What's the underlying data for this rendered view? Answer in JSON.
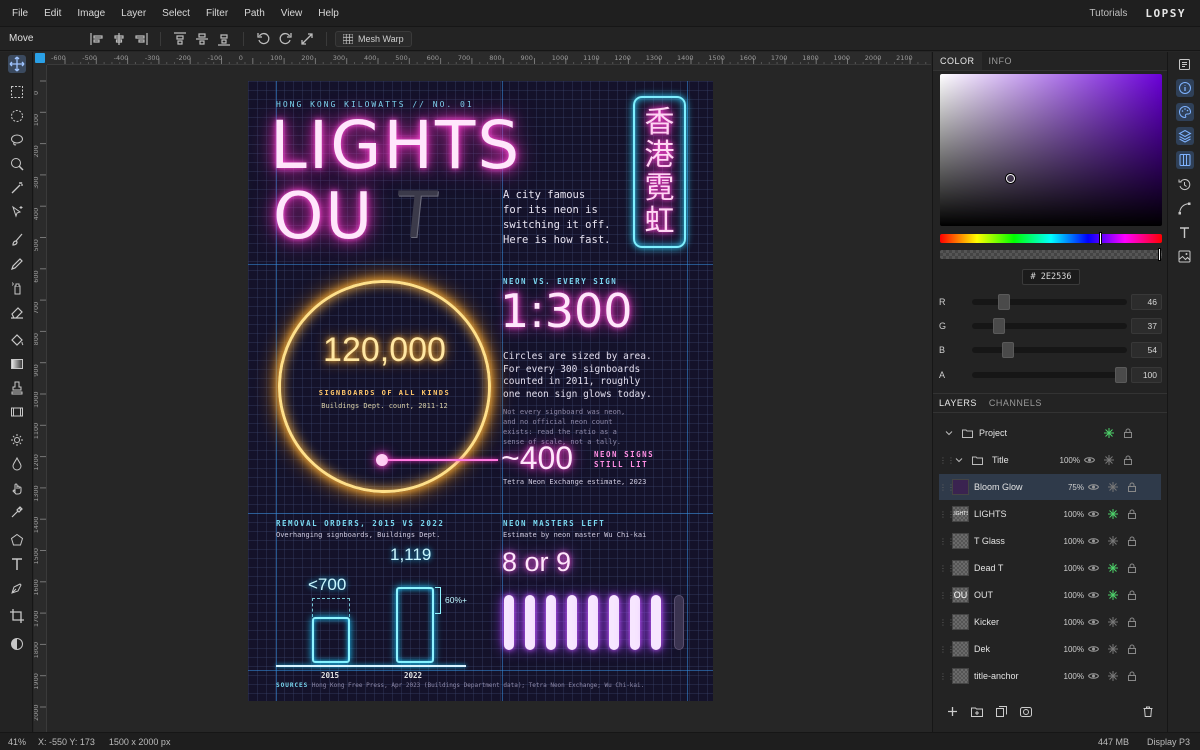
{
  "menubar": {
    "items": [
      "File",
      "Edit",
      "Image",
      "Layer",
      "Select",
      "Filter",
      "Path",
      "View",
      "Help"
    ],
    "tutorials": "Tutorials",
    "brand": "LOPSY"
  },
  "options": {
    "tool_name": "Move",
    "mesh_warp": "Mesh Warp"
  },
  "rulers": {
    "top": [
      "-600",
      "-500",
      "-400",
      "-300",
      "-200",
      "-100",
      "0",
      "100",
      "200",
      "300",
      "400",
      "500",
      "600",
      "700",
      "800",
      "900",
      "1000",
      "1100",
      "1200",
      "1300",
      "1400",
      "1500",
      "1600",
      "1700",
      "1800",
      "1900",
      "2000",
      "2100"
    ],
    "left": [
      "0",
      "100",
      "200",
      "300",
      "400",
      "500",
      "600",
      "700",
      "800",
      "900",
      "1000",
      "1100",
      "1200",
      "1300",
      "1400",
      "1500",
      "1600",
      "1700",
      "1800",
      "1900",
      "2000"
    ]
  },
  "poster": {
    "kicker": "HONG KONG KILOWATTS  //  NO. 01",
    "title_line1": "LIGHTS",
    "title_line2": "OU",
    "dead_letter": "T",
    "tagline": "A city famous\nfor its neon is\nswitching it off.\nHere is how fast.",
    "sign_chars": [
      "香",
      "港",
      "霓",
      "虹"
    ],
    "neon_vs_label": "NEON VS. EVERY SIGN",
    "ratio": "1:300",
    "body1": "Circles are sized by area.\nFor every 300 signboards\ncounted in 2011, roughly\none neon sign glows today.",
    "body2": "Not every signboard was neon,\nand no official neon count\nexists: read the ratio as a\nsense of scale, not a tally.",
    "big_number": "120,000",
    "signboards_label": "SIGNBOARDS OF ALL KINDS",
    "signboards_source": "Buildings Dept. count, 2011-12",
    "neon_count": "~400",
    "neon_count_label": "NEON SIGNS\nSTILL LIT",
    "neon_count_source": "Tetra Neon Exchange estimate, 2023",
    "removal_title": "REMOVAL ORDERS, 2015 VS 2022",
    "removal_sub": "Overhanging signboards, Buildings Dept.",
    "bar_2015_value": "<700",
    "bar_2022_value": "1,119",
    "bar_2015_year": "2015",
    "bar_2022_year": "2022",
    "bar_increase": "60%+",
    "masters_title": "NEON MASTERS LEFT",
    "masters_sub": "Estimate by neon master Wu Chi-kai",
    "masters_value": "8 or 9",
    "sources_label": "SOURCES",
    "sources_text": "Hong Kong Free Press, Apr 2023 (Buildings Department data); Tetra Neon Exchange; Wu Chi-kai."
  },
  "color_panel": {
    "tabs": [
      "COLOR",
      "INFO"
    ],
    "hex_label": "#",
    "hex": "2E2536",
    "channels": [
      {
        "label": "R",
        "value": "46",
        "fraction": 0.18
      },
      {
        "label": "G",
        "value": "37",
        "fraction": 0.145
      },
      {
        "label": "B",
        "value": "54",
        "fraction": 0.21
      },
      {
        "label": "A",
        "value": "100",
        "fraction": 1.0
      }
    ]
  },
  "layers_panel": {
    "tabs": [
      "LAYERS",
      "CHANNELS"
    ],
    "layers": [
      {
        "name": "Project",
        "opacity": ""
      },
      {
        "name": "Title",
        "opacity": "100%"
      },
      {
        "name": "Bloom Glow",
        "opacity": "75%"
      },
      {
        "name": "LIGHTS",
        "opacity": "100%",
        "thumb": "LIGHTS"
      },
      {
        "name": "T Glass",
        "opacity": "100%"
      },
      {
        "name": "Dead T",
        "opacity": "100%"
      },
      {
        "name": "OUT",
        "opacity": "100%",
        "thumb": "OU"
      },
      {
        "name": "Kicker",
        "opacity": "100%"
      },
      {
        "name": "Dek",
        "opacity": "100%"
      },
      {
        "name": "title-anchor",
        "opacity": "100%"
      }
    ]
  },
  "status": {
    "zoom": "41%",
    "coords": "X: -550  Y: 173",
    "dims": "1500 x 2000 px",
    "memory": "447 MB",
    "display": "Display P3"
  }
}
